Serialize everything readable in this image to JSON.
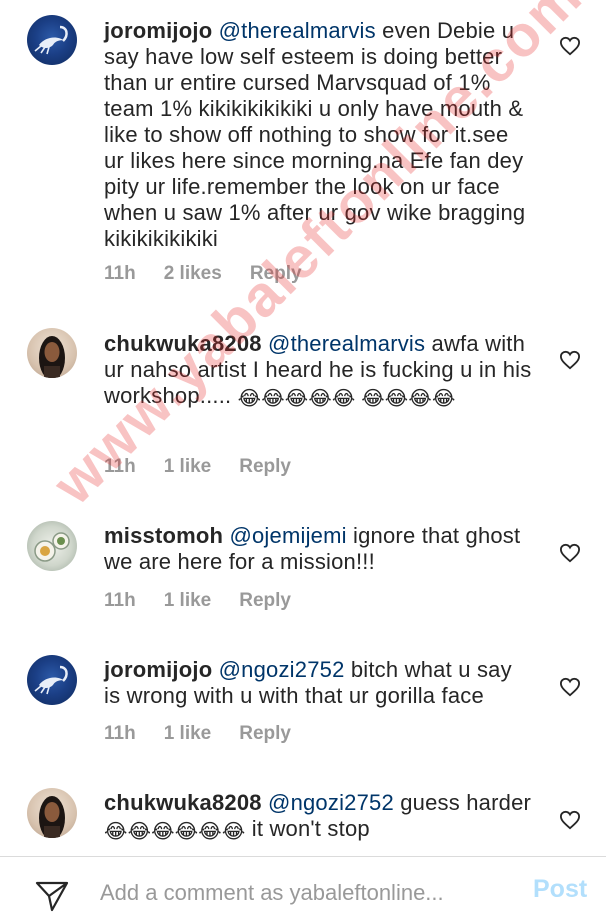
{
  "comments": [
    {
      "username": "joromijojo",
      "mention": "@therealmarvis",
      "text": "even Debie u say have low self esteem is doing better than ur entire cursed Marvsquad of 1% team 1% kikikikikikiki u only have mouth & like to show off nothing to show for it.see ur likes here since morning.na Efe fan dey pity ur life.remember the look on ur face when u saw 1% after ur gov wike bragging kikikikikikiki",
      "time": "11h",
      "likes": "2 likes",
      "reply": "Reply",
      "avatar": "scorpion-avatar"
    },
    {
      "username": "chukwuka8208",
      "mention": "@therealmarvis",
      "text": "awfa with ur nahso artist I heard he is fucking u in his workshop.....",
      "emoji": "😂😂😂😂😂 😂😂😂😂",
      "time": "11h",
      "likes": "1 like",
      "reply": "Reply",
      "avatar": "woman-avatar"
    },
    {
      "username": "misstomoh",
      "mention": "@ojemijemi",
      "text": "ignore that ghost we are here for a mission!!!",
      "time": "11h",
      "likes": "1 like",
      "reply": "Reply",
      "avatar": "food-avatar"
    },
    {
      "username": "joromijojo",
      "mention": "@ngozi2752",
      "text": "bitch what u say is wrong with u with that ur gorilla face",
      "time": "11h",
      "likes": "1 like",
      "reply": "Reply",
      "avatar": "scorpion-avatar"
    },
    {
      "username": "chukwuka8208",
      "mention": "@ngozi2752",
      "text": "guess harder",
      "emoji": "😂😂😂😂😂😂",
      "tail": "it won't stop",
      "avatar": "woman-avatar"
    }
  ],
  "watermark": "www.yabaleftonline.com",
  "composer": {
    "placeholder": "Add a comment as yabaleftonline...",
    "post_label": "Post"
  },
  "colors": {
    "mention": "#003569",
    "meta": "#999999",
    "post_disabled": "#b2dffc",
    "watermark": "#e62828"
  }
}
